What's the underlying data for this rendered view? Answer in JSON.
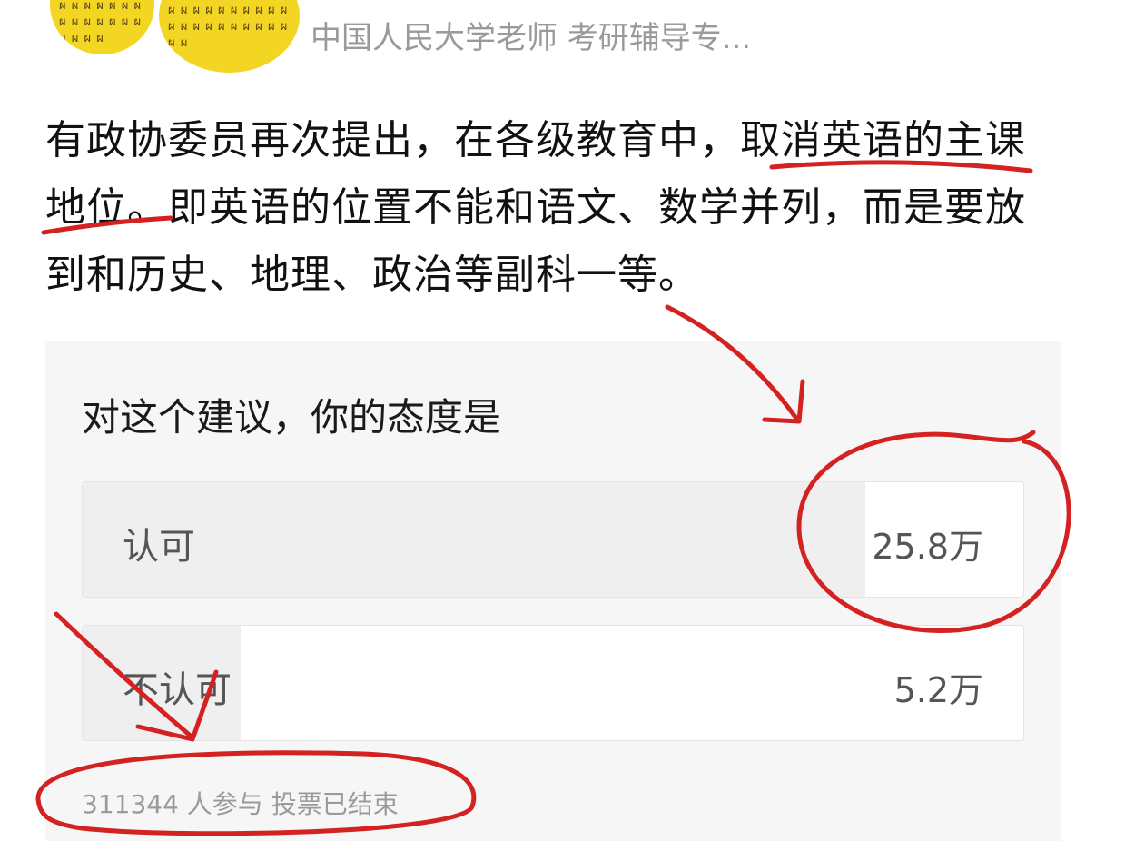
{
  "header": {
    "author_name": "中国人民大学老师 考研辅导专..."
  },
  "article": {
    "text": "有政协委员再次提出，在各级教育中，取消英语的主课地位。即英语的位置不能和语文、数学并列，而是要放到和历史、地理、政治等副科一等。"
  },
  "poll": {
    "question": "对这个建议，你的态度是",
    "options": [
      {
        "label": "认可",
        "count": "25.8万",
        "share": 0.832
      },
      {
        "label": "不认可",
        "count": "5.2万",
        "share": 0.168
      }
    ],
    "footer": "311344 人参与  投票已结束"
  },
  "colors": {
    "annotation_red": "#d42121",
    "avatar_yellow": "#f3d623",
    "card_background": "#f6f6f6"
  }
}
